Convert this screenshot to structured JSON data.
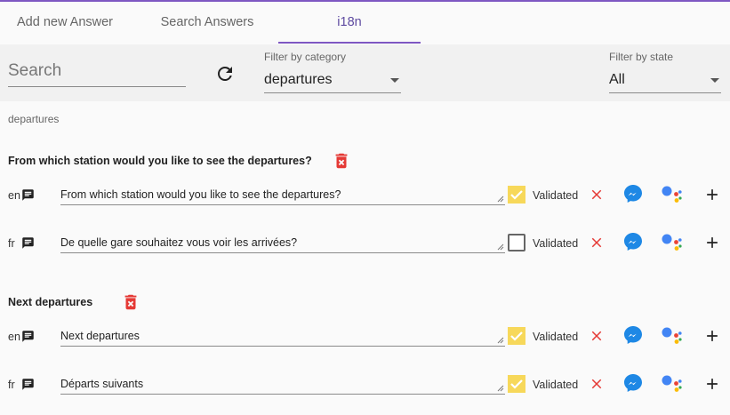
{
  "tabs": [
    {
      "label": "Add new Answer"
    },
    {
      "label": "Search Answers"
    },
    {
      "label": "i18n"
    }
  ],
  "filters": {
    "search_placeholder": "Search",
    "category_label": "Filter by category",
    "category_value": "departures",
    "state_label": "Filter by state",
    "state_value": "All"
  },
  "breadcrumb": "departures",
  "questions": [
    {
      "title": "From which station would you like to see the departures?",
      "rows": [
        {
          "lang": "en",
          "text": "From which station would you like to see the departures?",
          "validated": true,
          "validated_label": "Validated"
        },
        {
          "lang": "fr",
          "text": "De quelle gare souhaitez vous voir les arrivées?",
          "validated": false,
          "validated_label": "Validated"
        }
      ]
    },
    {
      "title": "Next departures",
      "rows": [
        {
          "lang": "en",
          "text": "Next departures",
          "validated": true,
          "validated_label": "Validated"
        },
        {
          "lang": "fr",
          "text": "Départs suivants",
          "validated": true,
          "validated_label": "Validated"
        }
      ]
    }
  ],
  "colors": {
    "accent": "#7e57c2",
    "delete": "#e53935",
    "checked": "#f7d85a",
    "messenger": "#1e88e5"
  }
}
